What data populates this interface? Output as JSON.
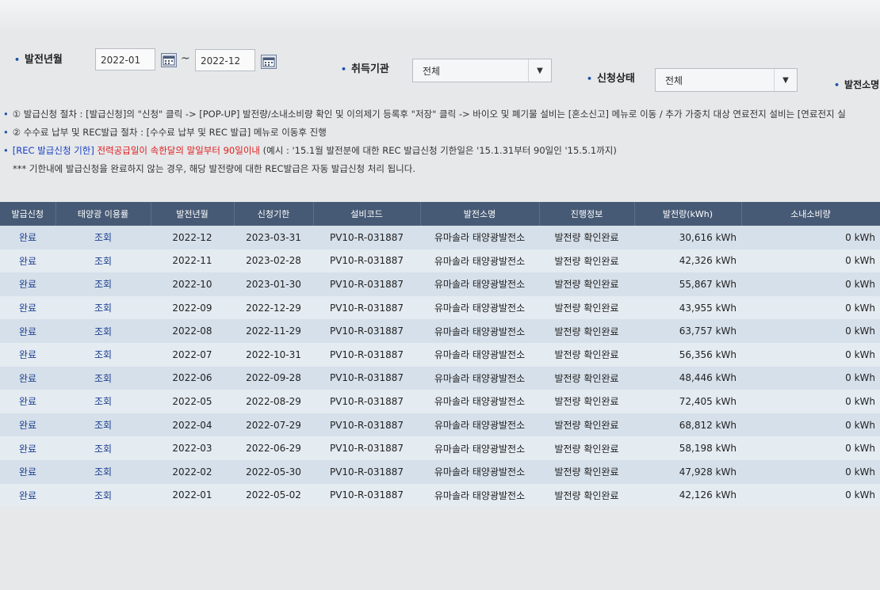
{
  "search": {
    "period_label": "발전년월",
    "start": "2022-01",
    "end": "2022-12",
    "tilde": "~",
    "agency_label": "취득기관",
    "agency_value": "전체",
    "status_label": "신청상태",
    "status_value": "전체",
    "plant_label": "발전소명"
  },
  "notes": {
    "n1": "① 발급신청 절차 : [발급신청]의 \"신청\" 클릭 -> [POP-UP] 발전량/소내소비량 확인 및 이의제기 등록후 \"저장\" 클릭 -> 바이오 및 폐기물 설비는 [혼소신고] 메뉴로 이동 / 추가 가중치 대상 연료전지 설비는 [연료전지 실",
    "n2": "② 수수료 납부 및 REC발급 절차 : [수수료 납부 및 REC 발급] 메뉴로 이동후 진행",
    "n3_blue": "[REC 발급신청 기한]",
    "n3_red": "전력공급일이 속한달의 말일부터 90일이내",
    "n3_rest": "(예시 : '15.1월 발전분에 대한 REC 발급신청 기한일은 '15.1.31부터 90일인 '15.5.1까지)",
    "n4": "*** 기한내에 발급신청을 완료하지 않는 경우, 해당 발전량에 대한 REC발급은 자동 발급신청 처리 됩니다."
  },
  "table": {
    "headers": [
      "발급신청",
      "태양광 이용률",
      "발전년월",
      "신청기한",
      "설비코드",
      "발전소명",
      "진행정보",
      "발전량(kWh)",
      "소내소비량"
    ],
    "rows": [
      {
        "status": "완료",
        "view": "조회",
        "month": "2022-12",
        "deadline": "2023-03-31",
        "code": "PV10-R-031887",
        "plant": "유마솔라 태양광발전소",
        "progress": "발전량 확인완료",
        "gen": "30,616 kWh",
        "self": "0 kWh"
      },
      {
        "status": "완료",
        "view": "조회",
        "month": "2022-11",
        "deadline": "2023-02-28",
        "code": "PV10-R-031887",
        "plant": "유마솔라 태양광발전소",
        "progress": "발전량 확인완료",
        "gen": "42,326 kWh",
        "self": "0 kWh"
      },
      {
        "status": "완료",
        "view": "조회",
        "month": "2022-10",
        "deadline": "2023-01-30",
        "code": "PV10-R-031887",
        "plant": "유마솔라 태양광발전소",
        "progress": "발전량 확인완료",
        "gen": "55,867 kWh",
        "self": "0 kWh"
      },
      {
        "status": "완료",
        "view": "조회",
        "month": "2022-09",
        "deadline": "2022-12-29",
        "code": "PV10-R-031887",
        "plant": "유마솔라 태양광발전소",
        "progress": "발전량 확인완료",
        "gen": "43,955 kWh",
        "self": "0 kWh"
      },
      {
        "status": "완료",
        "view": "조회",
        "month": "2022-08",
        "deadline": "2022-11-29",
        "code": "PV10-R-031887",
        "plant": "유마솔라 태양광발전소",
        "progress": "발전량 확인완료",
        "gen": "63,757 kWh",
        "self": "0 kWh"
      },
      {
        "status": "완료",
        "view": "조회",
        "month": "2022-07",
        "deadline": "2022-10-31",
        "code": "PV10-R-031887",
        "plant": "유마솔라 태양광발전소",
        "progress": "발전량 확인완료",
        "gen": "56,356 kWh",
        "self": "0 kWh"
      },
      {
        "status": "완료",
        "view": "조회",
        "month": "2022-06",
        "deadline": "2022-09-28",
        "code": "PV10-R-031887",
        "plant": "유마솔라 태양광발전소",
        "progress": "발전량 확인완료",
        "gen": "48,446 kWh",
        "self": "0 kWh"
      },
      {
        "status": "완료",
        "view": "조회",
        "month": "2022-05",
        "deadline": "2022-08-29",
        "code": "PV10-R-031887",
        "plant": "유마솔라 태양광발전소",
        "progress": "발전량 확인완료",
        "gen": "72,405 kWh",
        "self": "0 kWh"
      },
      {
        "status": "완료",
        "view": "조회",
        "month": "2022-04",
        "deadline": "2022-07-29",
        "code": "PV10-R-031887",
        "plant": "유마솔라 태양광발전소",
        "progress": "발전량 확인완료",
        "gen": "68,812 kWh",
        "self": "0 kWh"
      },
      {
        "status": "완료",
        "view": "조회",
        "month": "2022-03",
        "deadline": "2022-06-29",
        "code": "PV10-R-031887",
        "plant": "유마솔라 태양광발전소",
        "progress": "발전량 확인완료",
        "gen": "58,198 kWh",
        "self": "0 kWh"
      },
      {
        "status": "완료",
        "view": "조회",
        "month": "2022-02",
        "deadline": "2022-05-30",
        "code": "PV10-R-031887",
        "plant": "유마솔라 태양광발전소",
        "progress": "발전량 확인완료",
        "gen": "47,928 kWh",
        "self": "0 kWh"
      },
      {
        "status": "완료",
        "view": "조회",
        "month": "2022-01",
        "deadline": "2022-05-02",
        "code": "PV10-R-031887",
        "plant": "유마솔라 태양광발전소",
        "progress": "발전량 확인완료",
        "gen": "42,126 kWh",
        "self": "0 kWh"
      }
    ]
  },
  "colors": {
    "header_bg": "#475a75",
    "row_odd": "#d6e0ea",
    "row_even": "#e4ebf1",
    "link": "#1d3f8f",
    "red": "#e01b1b",
    "blue": "#1a3fc4"
  },
  "icons": {
    "calendar": "calendar-icon",
    "dropdown": "chevron-down-icon"
  }
}
